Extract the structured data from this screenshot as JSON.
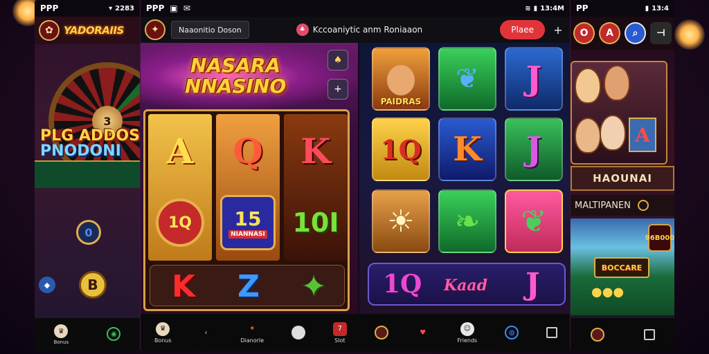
{
  "left_phone": {
    "status": {
      "left": "PPP",
      "time": "2283"
    },
    "logo": "YADORAIIS",
    "roulette_number": "3",
    "promo_line1": "PLG ADDOS",
    "promo_line2": "PNODONI",
    "chip_label": "0",
    "coin_label": "B",
    "nav": [
      {
        "icon": "trophy-icon",
        "label": "Bonus"
      },
      {
        "icon": "shield-icon",
        "label": ""
      }
    ]
  },
  "main_phone": {
    "status": {
      "left": "PPP",
      "right": "13:4M"
    },
    "header": {
      "tab_label": "Naaonitio  Doson",
      "title": "Kccoaniytic anm Roniaaon",
      "cta_label": "Plaee",
      "plus": "+"
    },
    "game_left": {
      "logo_line1": "NASARA",
      "logo_line2": "NNASINO",
      "side_btn_1": "♠",
      "side_btn_2": "+",
      "reel_symbols": [
        "A",
        "Q",
        "K"
      ],
      "badges": [
        {
          "label": "1Q"
        },
        {
          "label": "15",
          "sub": "NIANNASI"
        },
        {
          "label": "10I"
        }
      ],
      "bottom_symbols": [
        "K",
        "Z",
        "✦"
      ]
    },
    "game_right": {
      "tiles_row1": [
        {
          "label": "PAIDRAS",
          "kind": "portrait"
        },
        {
          "label": "",
          "kind": "leaf"
        },
        {
          "label": "J",
          "kind": "letter"
        }
      ],
      "tiles_row2": [
        {
          "label": "1Q",
          "kind": "letter"
        },
        {
          "label": "K",
          "kind": "letter"
        },
        {
          "label": "J",
          "kind": "letter"
        }
      ],
      "tiles_row3": [
        {
          "label": "",
          "kind": "sun"
        },
        {
          "label": "",
          "kind": "leaf"
        },
        {
          "label": "",
          "kind": "leaf"
        }
      ],
      "wide_tile_left": "1Q",
      "wide_tile_mid": "Kaad",
      "wide_tile_right": "J"
    },
    "nav": [
      {
        "icon": "vip-icon",
        "label": "Bonus"
      },
      {
        "icon": "back-icon",
        "label": ""
      },
      {
        "icon": "star-icon",
        "label": "Dianorle"
      },
      {
        "icon": "circle-icon",
        "label": ""
      },
      {
        "icon": "slot-icon",
        "label": "Slot"
      },
      {
        "icon": "chip-icon",
        "label": ""
      },
      {
        "icon": "heart-icon",
        "label": ""
      },
      {
        "icon": "face-icon",
        "label": "Friends"
      },
      {
        "icon": "globe-icon",
        "label": ""
      },
      {
        "icon": "square-icon",
        "label": ""
      }
    ]
  },
  "right_phone": {
    "status": {
      "left": "PP",
      "right": "13:4"
    },
    "header_btn_1": "O",
    "header_btn_2": "A",
    "banner": "HAOUNAI",
    "subtitle": "MALTIPANEN",
    "board_badge_top": "96B",
    "board_badge_bottom": "000",
    "board_logo": "BOCCARE",
    "tile_letter": "A"
  },
  "colors": {
    "accent_red": "#e0343a",
    "gold": "#ffd23a",
    "bg_dark": "#14081c"
  }
}
